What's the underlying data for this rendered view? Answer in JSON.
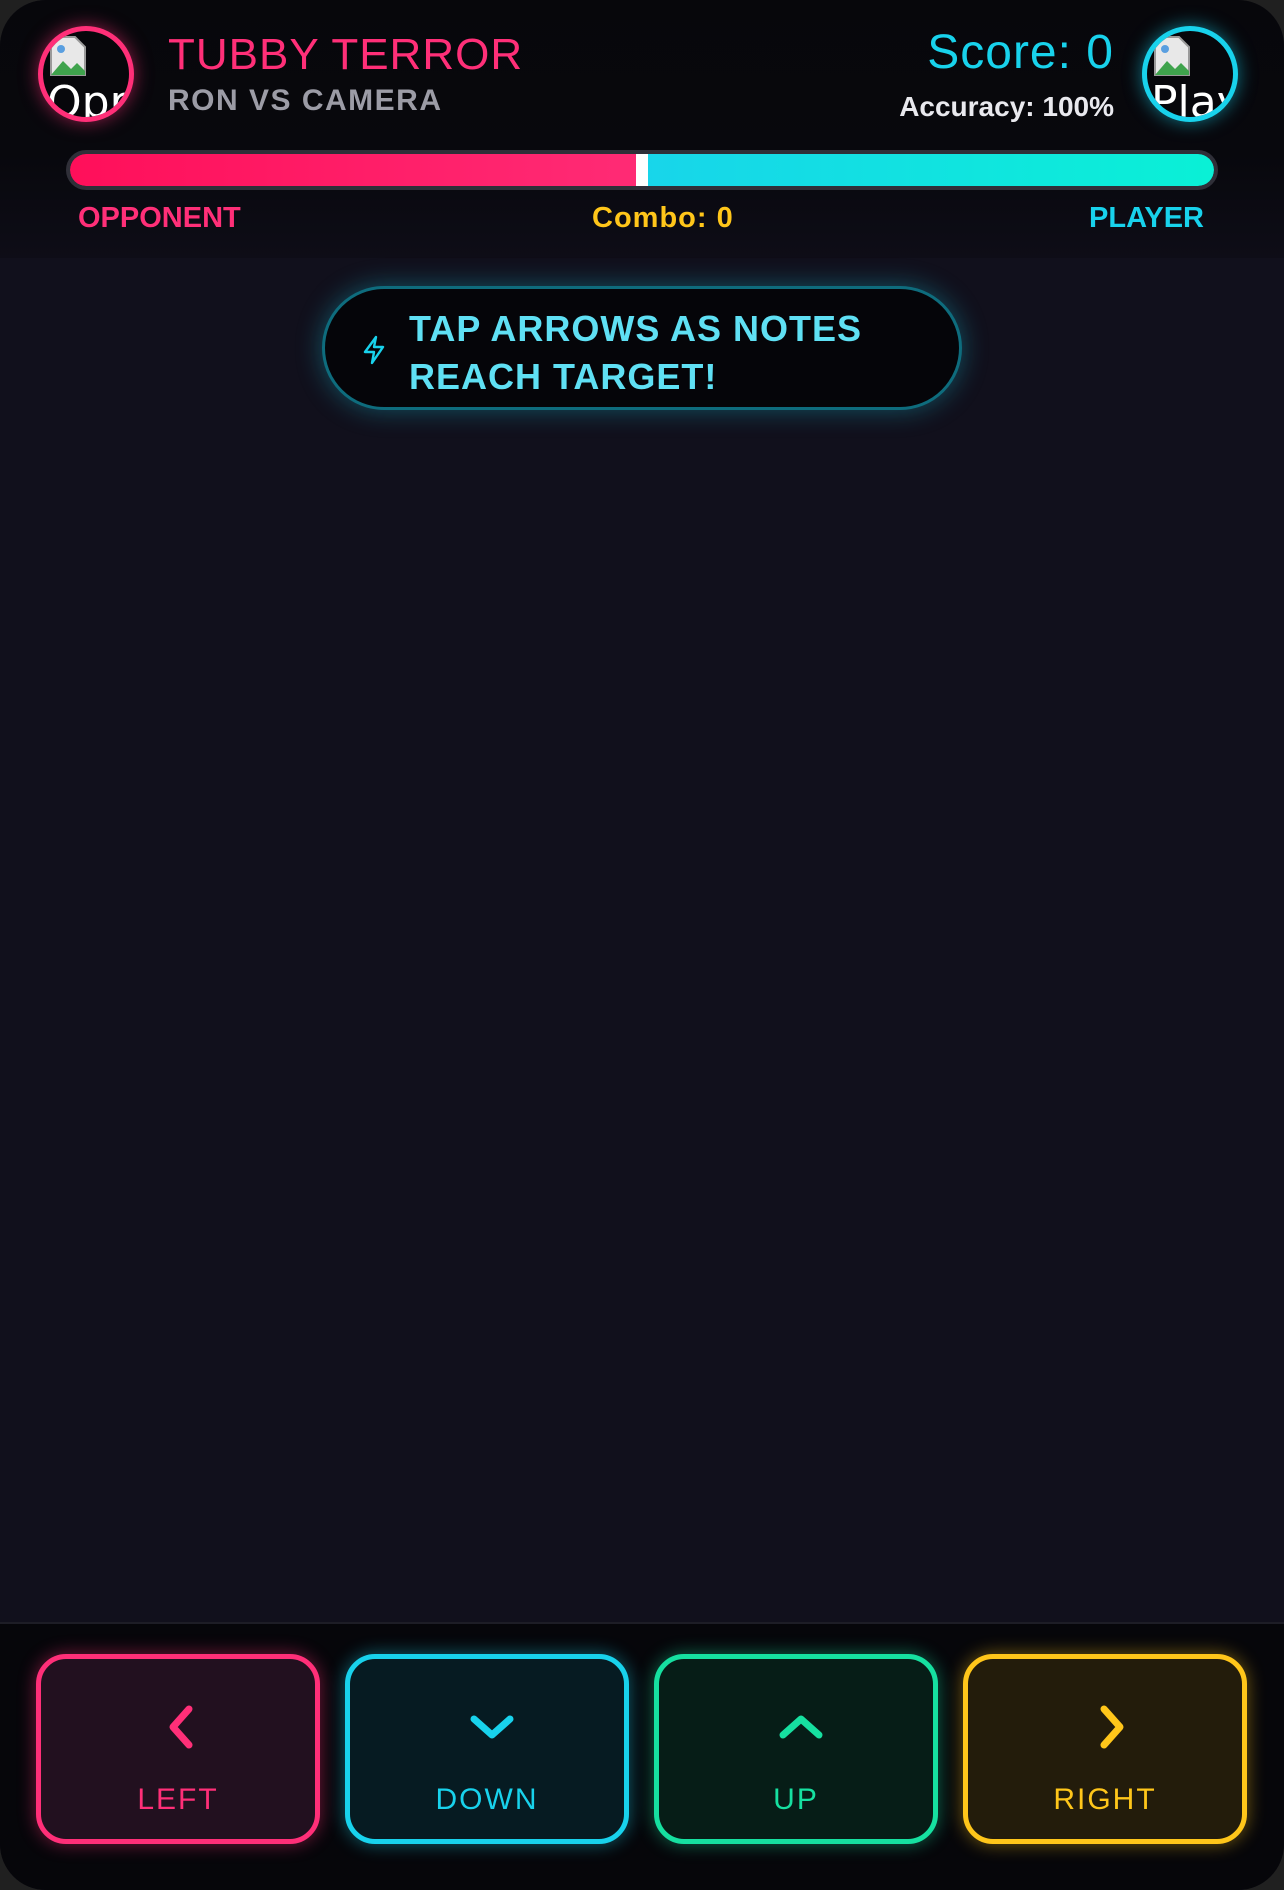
{
  "header": {
    "song_title": "TUBBY TERROR",
    "song_subtitle": "RON VS CAMERA",
    "score_text": "Score: 0",
    "accuracy_text": "Accuracy: 100%",
    "opponent_avatar_alt": "Opp",
    "player_avatar_alt": "Play"
  },
  "health_bar": {
    "opponent_fraction": 0.5,
    "opponent_label": "OPPONENT",
    "player_label": "PLAYER",
    "combo_text": "Combo: 0"
  },
  "hint": {
    "text": "TAP ARROWS AS NOTES REACH TARGET!",
    "icon": "lightning-bolt-icon"
  },
  "controls": {
    "left_label": "LEFT",
    "down_label": "DOWN",
    "up_label": "UP",
    "right_label": "RIGHT"
  },
  "colors": {
    "opponent": "#ff2f78",
    "player": "#18d2ec",
    "combo": "#ffc61a",
    "up": "#16e0a0",
    "background": "#11101c"
  }
}
